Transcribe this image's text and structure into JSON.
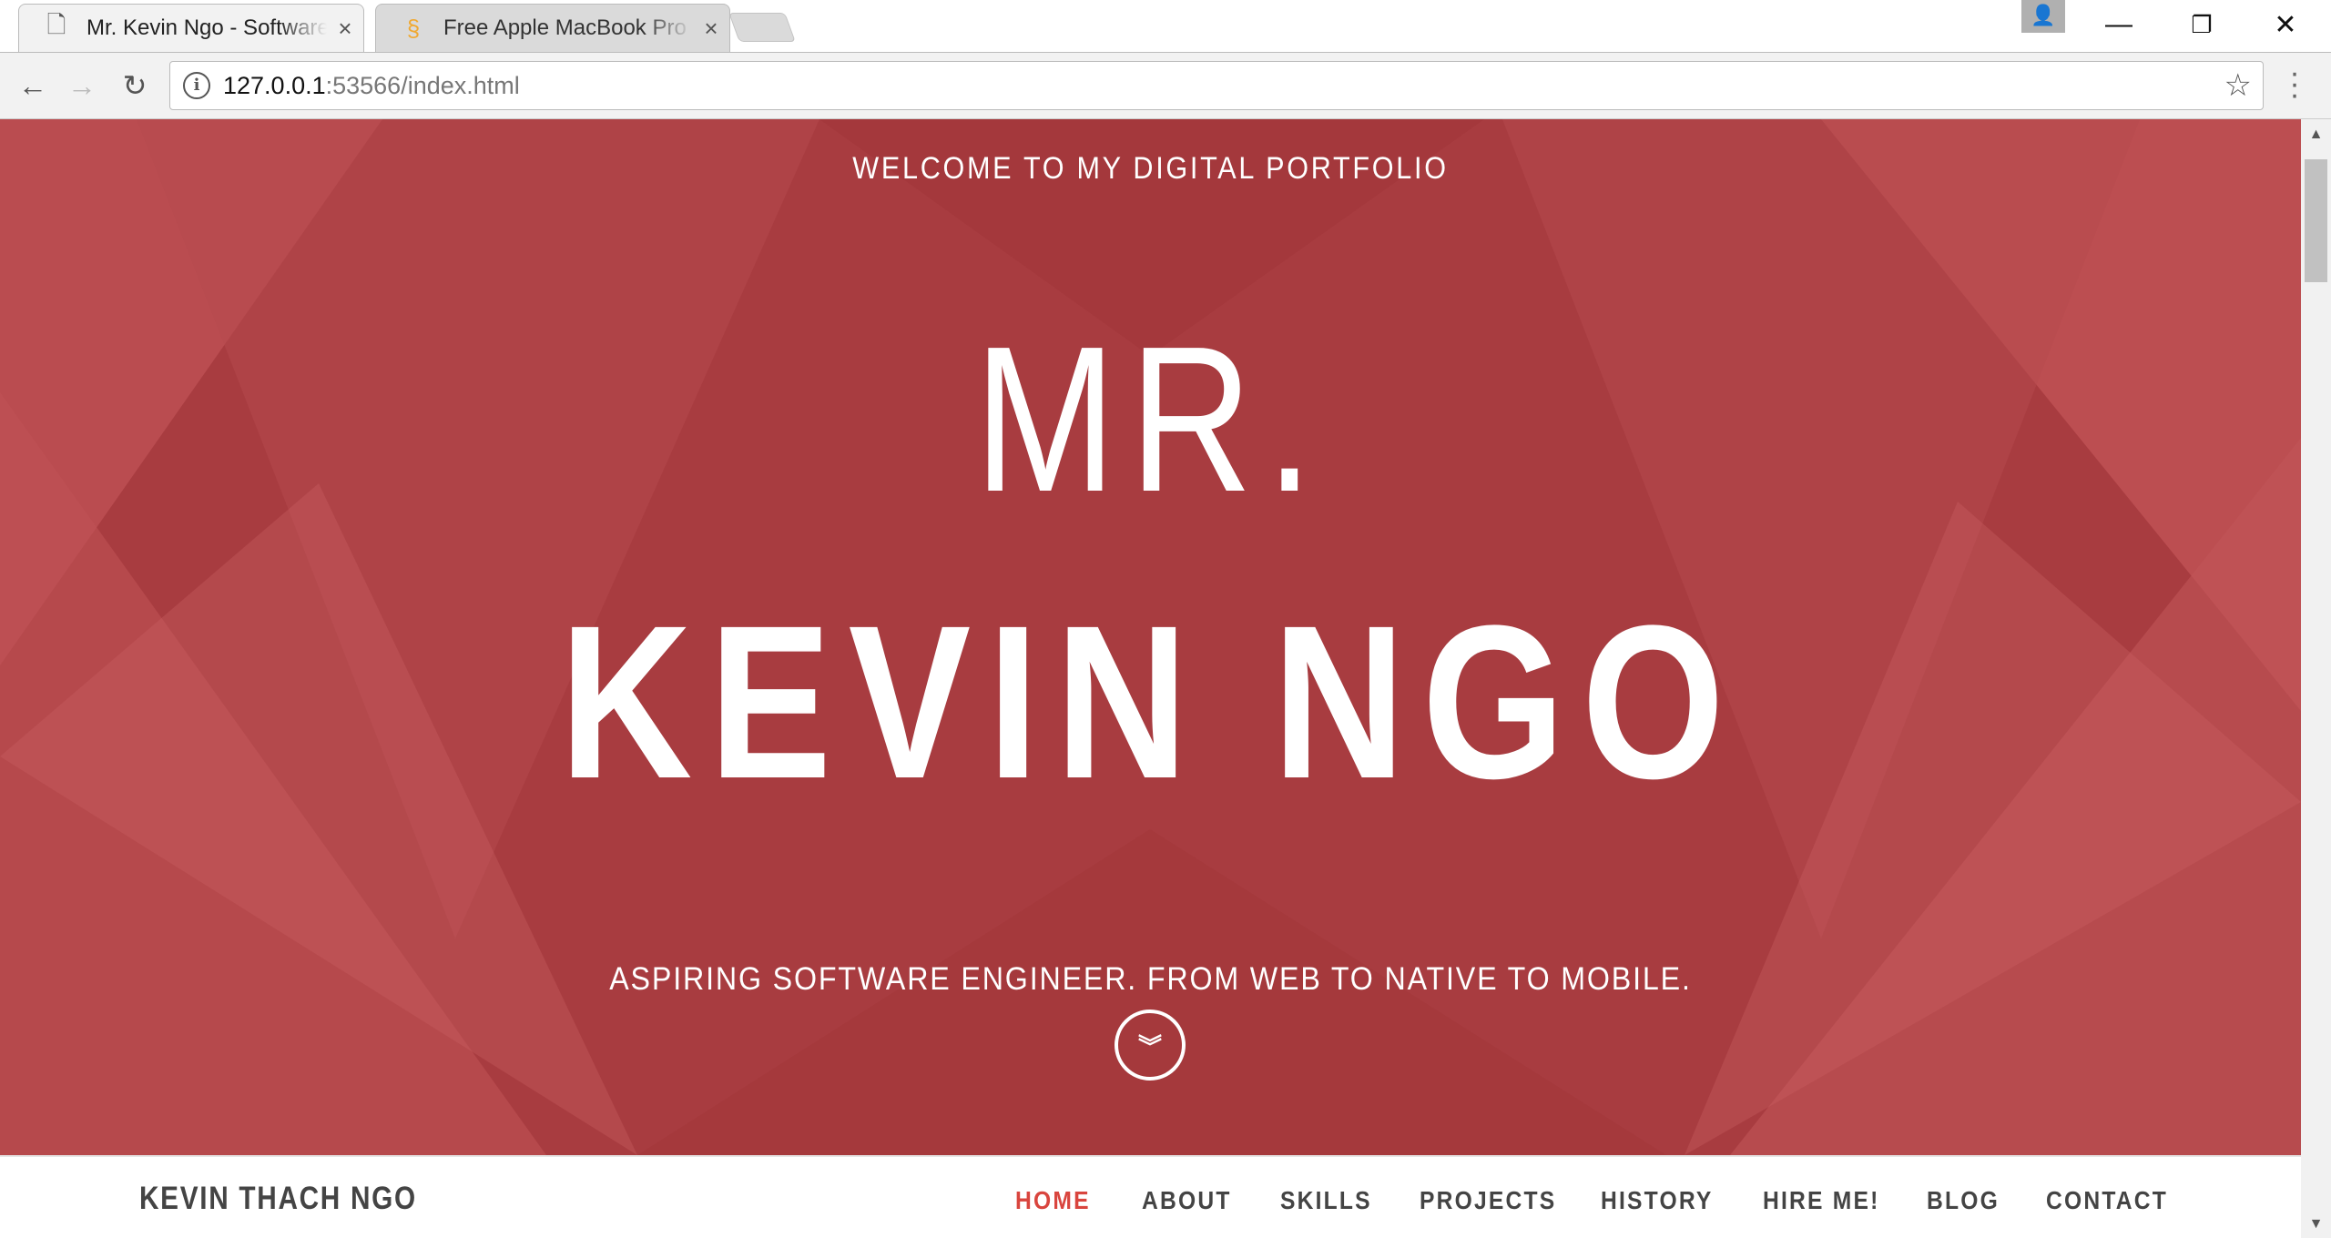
{
  "browser": {
    "tabs": [
      {
        "title": "Mr. Kevin Ngo - Software Engineer",
        "icon": "document-icon",
        "active": true
      },
      {
        "title": "Free Apple MacBook Pro",
        "icon": "stacked-coin-icon",
        "active": false
      }
    ],
    "url_host": "127.0.0.1",
    "url_rest": ":53566/index.html"
  },
  "hero": {
    "welcome": "WELCOME TO MY DIGITAL PORTFOLIO",
    "prefix": "MR.",
    "name": "KEVIN NGO",
    "tagline": "ASPIRING SOFTWARE ENGINEER. FROM WEB TO NATIVE TO MOBILE.",
    "background_color": "#a83c40"
  },
  "navbar": {
    "logo": "KEVIN THACH NGO",
    "items": [
      "HOME",
      "ABOUT",
      "SKILLS",
      "PROJECTS",
      "HISTORY",
      "HIRE ME!",
      "BLOG",
      "CONTACT"
    ],
    "active": "HOME",
    "active_color": "#d9453e"
  }
}
